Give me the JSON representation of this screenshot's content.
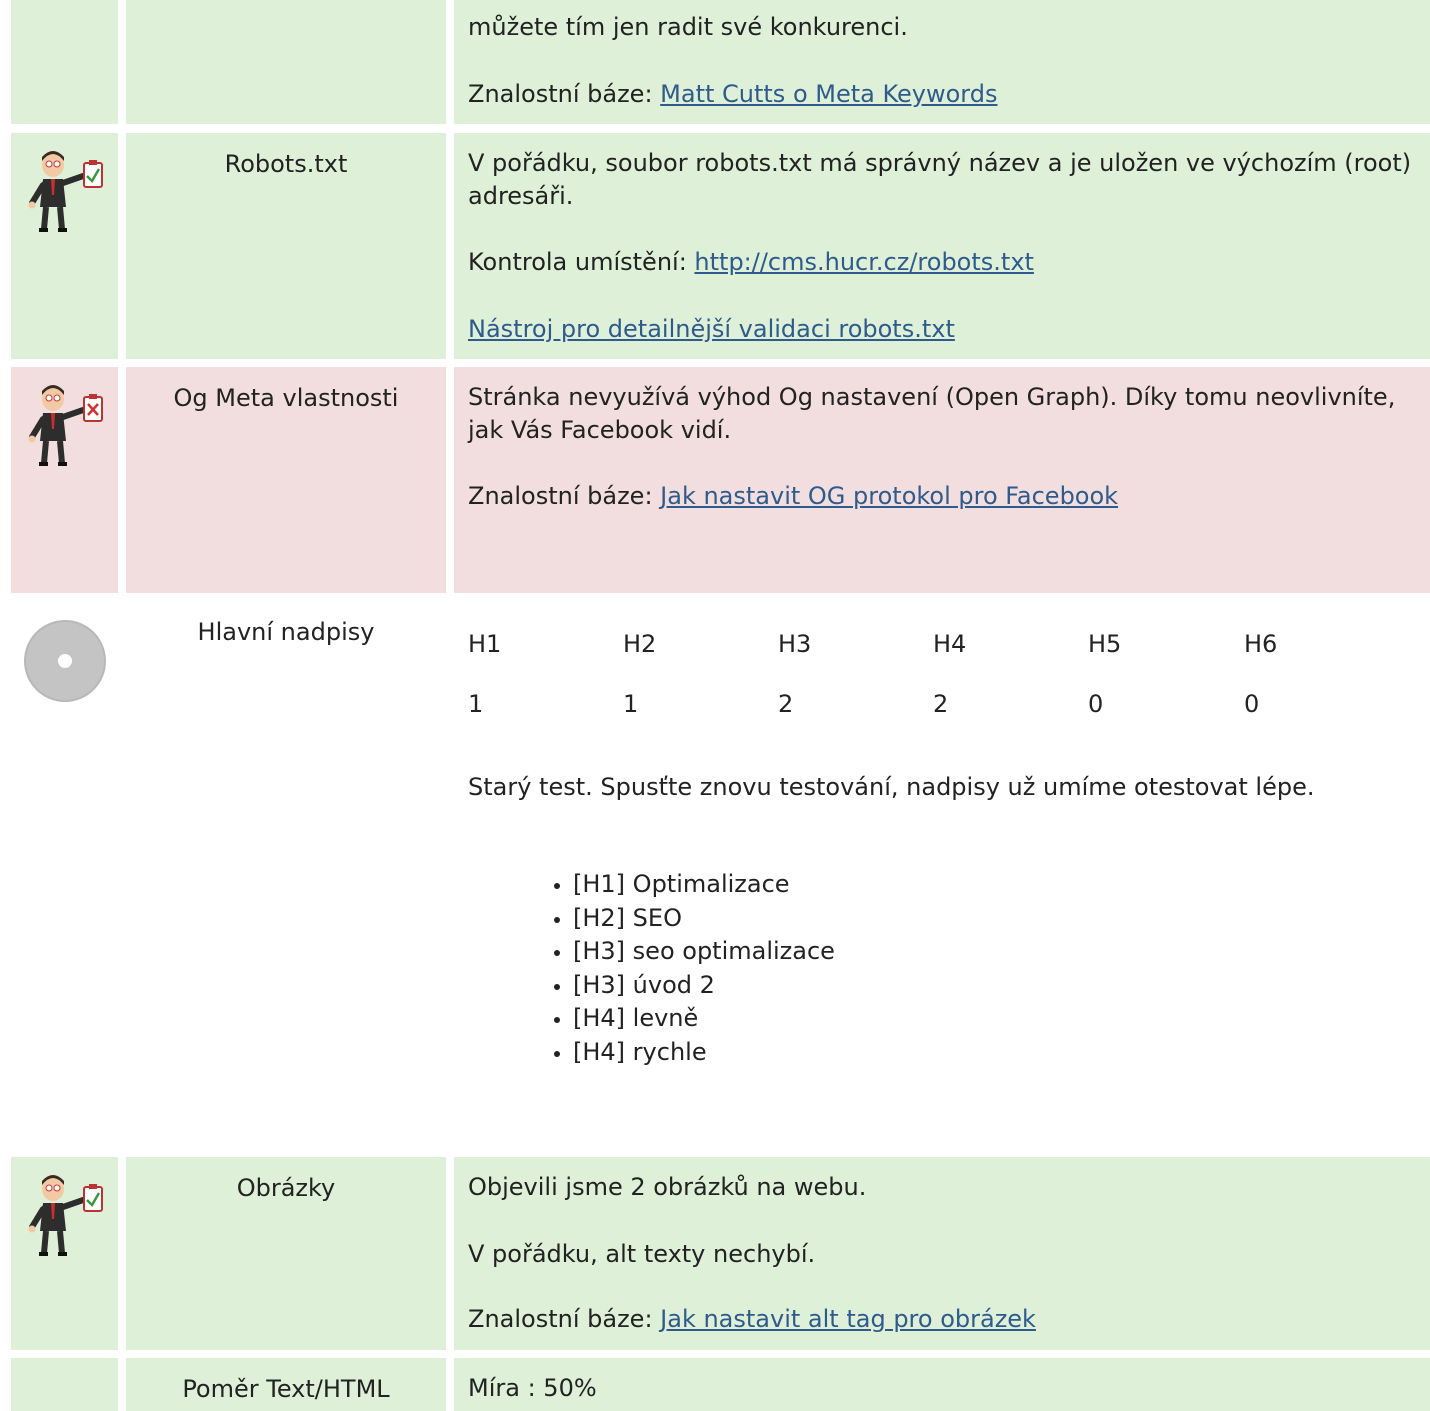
{
  "rows": {
    "keywords": {
      "body_line1": "můžete tím jen radit své konkurenci.",
      "kb_label": "Znalostní báze: ",
      "kb_link": "Matt Cutts o Meta Keywords"
    },
    "robots": {
      "name": "Robots.txt",
      "text": "V pořádku, soubor robots.txt má správný název a je uložen ve výchozím (root) adresáři.",
      "location_label": "Kontrola umístění: ",
      "location_link": "http://cms.hucr.cz/robots.txt",
      "tool_link": "Nástroj pro detailnější validaci robots.txt"
    },
    "og": {
      "name": "Og Meta vlastnosti",
      "text": "Stránka nevyužívá výhod Og nastavení (Open Graph). Díky tomu neovlivníte, jak Vás Facebook vidí.",
      "kb_label": "Znalostní báze: ",
      "kb_link": "Jak nastavit OG protokol pro Facebook"
    },
    "headings": {
      "name": "Hlavní nadpisy",
      "columns": [
        "H1",
        "H2",
        "H3",
        "H4",
        "H5",
        "H6"
      ],
      "counts": [
        "1",
        "1",
        "2",
        "2",
        "0",
        "0"
      ],
      "note": "Starý test. Spusťte znovu testování, nadpisy už umíme otestovat lépe.",
      "list": [
        "[H1] Optimalizace",
        "[H2] SEO",
        "[H3] seo optimalizace",
        "[H3] úvod 2",
        "[H4] levně",
        "[H4] rychle"
      ]
    },
    "images": {
      "name": "Obrázky",
      "found": "Objevili jsme 2 obrázků na webu.",
      "alt_status": "V pořádku, alt texty nechybí.",
      "kb_label": "Znalostní báze: ",
      "kb_link": "Jak nastavit alt tag pro obrázek"
    },
    "ratio": {
      "name": "Poměr Text/HTML",
      "value": "Míra : 50%"
    }
  },
  "colors": {
    "ok_bg": "#def0d8",
    "bad_bg": "#f2dede",
    "link": "#2f5b8c"
  },
  "icons": [
    "businessman-ok-icon",
    "businessman-error-icon",
    "neutral-disc-icon"
  ]
}
